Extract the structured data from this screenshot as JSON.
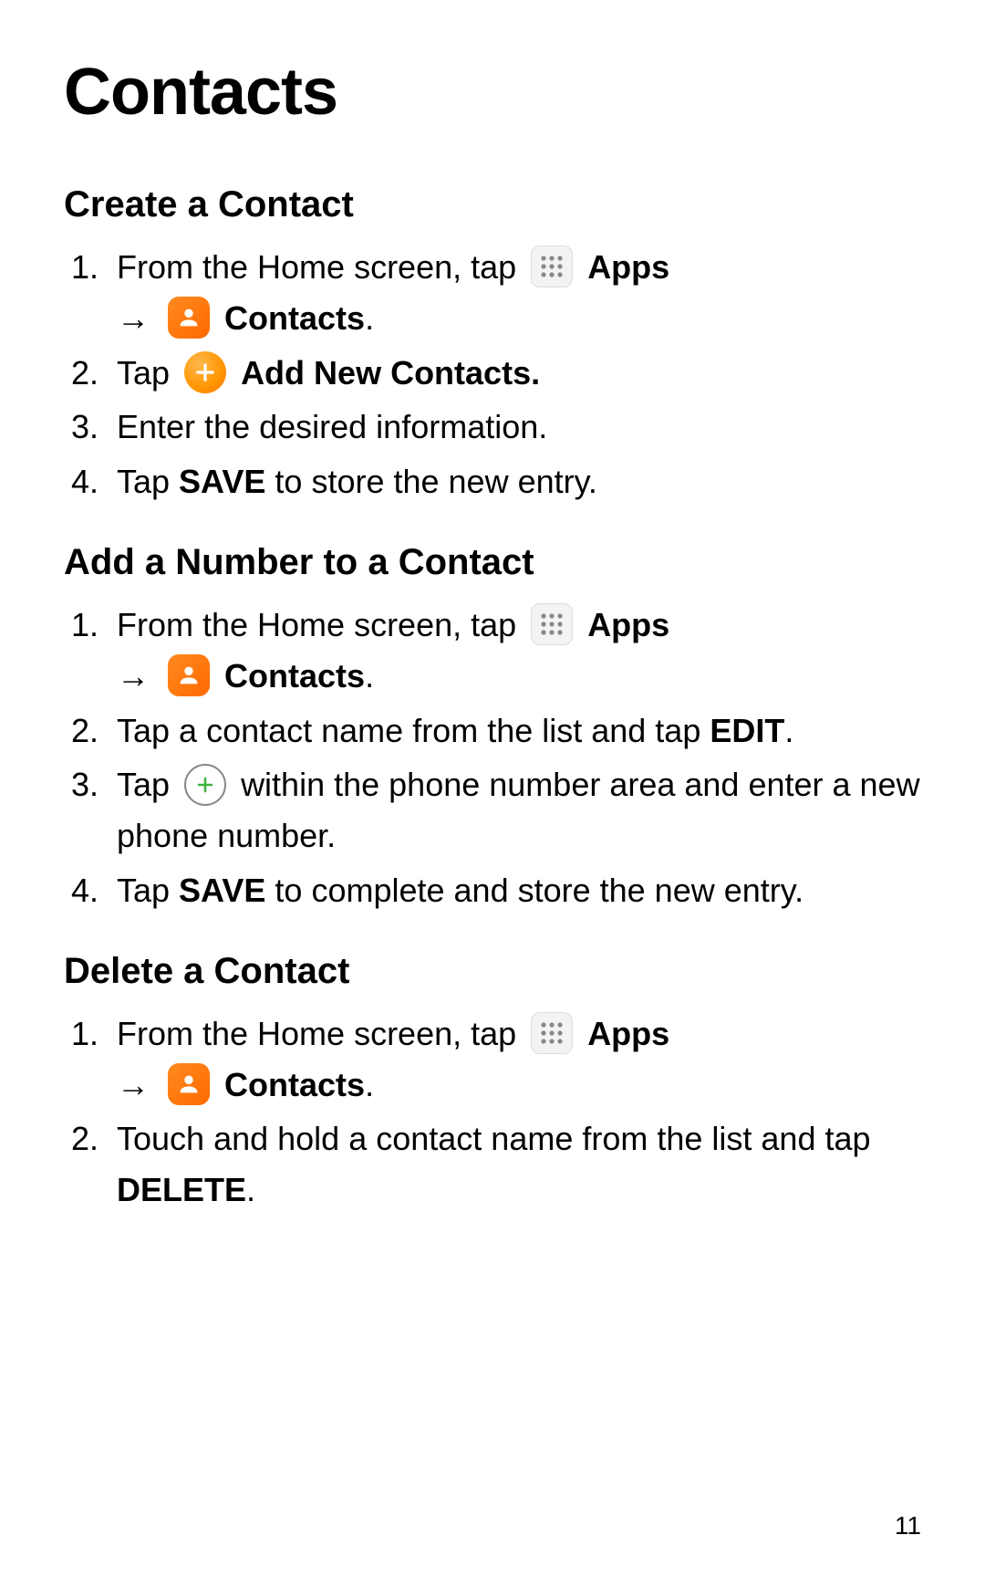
{
  "title": "Contacts",
  "page_number": "11",
  "labels": {
    "apps": "Apps",
    "contacts": "Contacts",
    "add_new": "Add New Contacts.",
    "save": "SAVE",
    "edit": "EDIT",
    "delete": "DELETE",
    "arrow": "→"
  },
  "sections": {
    "create": {
      "heading": "Create a Contact",
      "step1_prefix": "From the Home screen, tap ",
      "step2_prefix": "Tap ",
      "step3": "Enter the desired information.",
      "step4_prefix": "Tap ",
      "step4_suffix": " to store the new entry."
    },
    "add_number": {
      "heading": "Add a Number to a Contact",
      "step1_prefix": "From the Home screen, tap ",
      "step2_a": "Tap a contact name from the list and tap ",
      "step2_b": ".",
      "step3_prefix": "Tap ",
      "step3_suffix": " within the phone number area and enter a new phone number.",
      "step4_prefix": "Tap ",
      "step4_suffix": " to complete and store the new entry."
    },
    "delete": {
      "heading": "Delete a Contact",
      "step1_prefix": "From the Home screen, tap ",
      "step2_a": "Touch and hold a contact name from the list and tap ",
      "step2_b": "."
    }
  }
}
